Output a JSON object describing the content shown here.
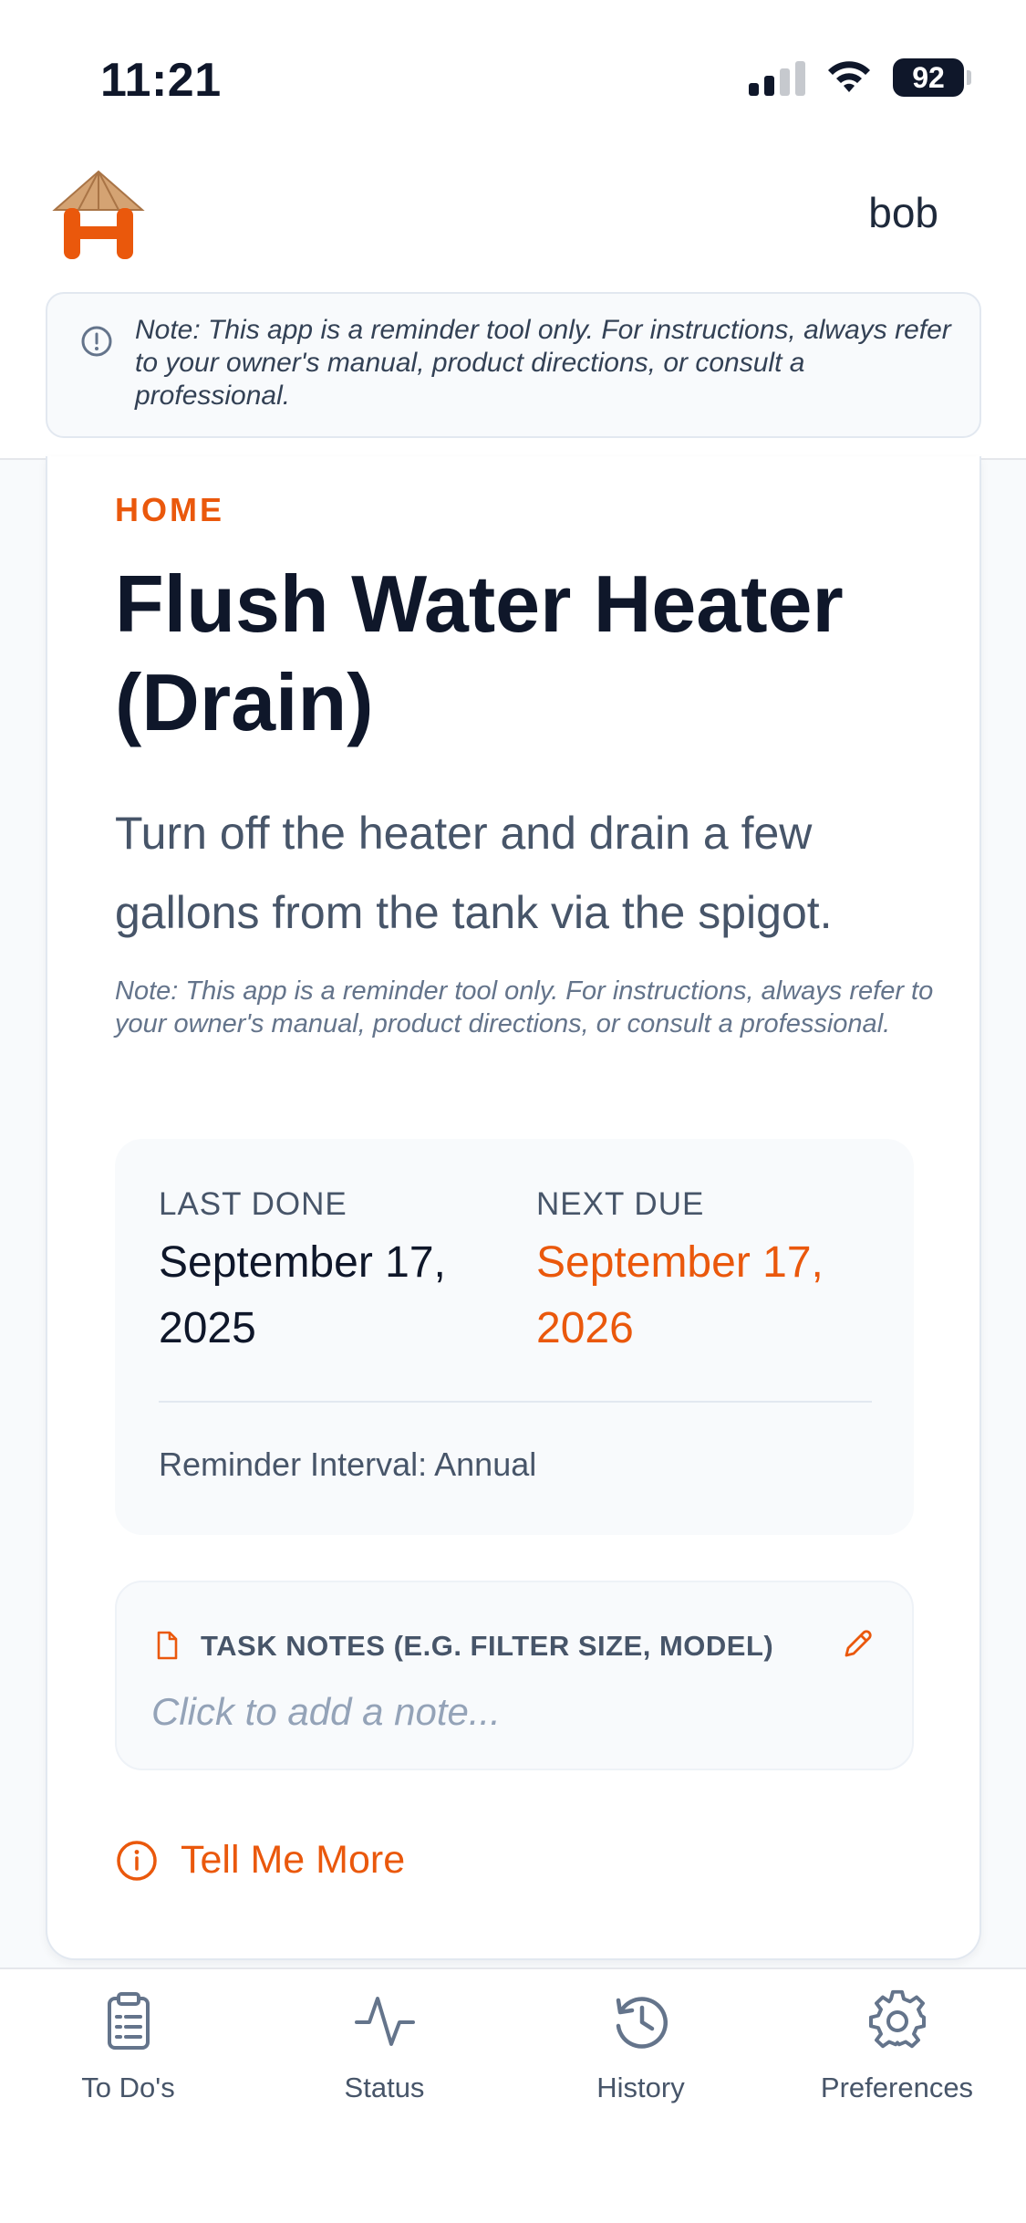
{
  "status_bar": {
    "time": "11:21",
    "battery": "92"
  },
  "header": {
    "user_name": "bob",
    "disclaimer": "Note: This app is a reminder tool only. For instructions, always refer to your owner's manual, product directions, or consult a professional."
  },
  "task": {
    "category": "HOME",
    "title": "Flush Water Heater (Drain)",
    "description": "Turn off the heater and drain a few gallons from the tank via the spigot.",
    "note": "Note: This app is a reminder tool only. For instructions, always refer to your owner's manual, product directions, or consult a professional.",
    "last_done_label": "LAST DONE",
    "last_done_value": "September 17, 2025",
    "next_due_label": "NEXT DUE",
    "next_due_value": "September 17, 2026",
    "interval": "Reminder Interval: Annual",
    "notes_label": "TASK NOTES (E.G. FILTER SIZE, MODEL)",
    "notes_placeholder": "Click to add a note...",
    "tell_more_label": "Tell Me More"
  },
  "tabs": [
    {
      "label": "To Do's",
      "icon": "clipboard-list-icon"
    },
    {
      "label": "Status",
      "icon": "activity-icon"
    },
    {
      "label": "History",
      "icon": "history-icon"
    },
    {
      "label": "Preferences",
      "icon": "gear-icon"
    }
  ],
  "colors": {
    "accent": "#ea580c",
    "text_primary": "#0f172a",
    "text_secondary": "#475569",
    "muted": "#94a3b8",
    "surface": "#f8fafc"
  }
}
